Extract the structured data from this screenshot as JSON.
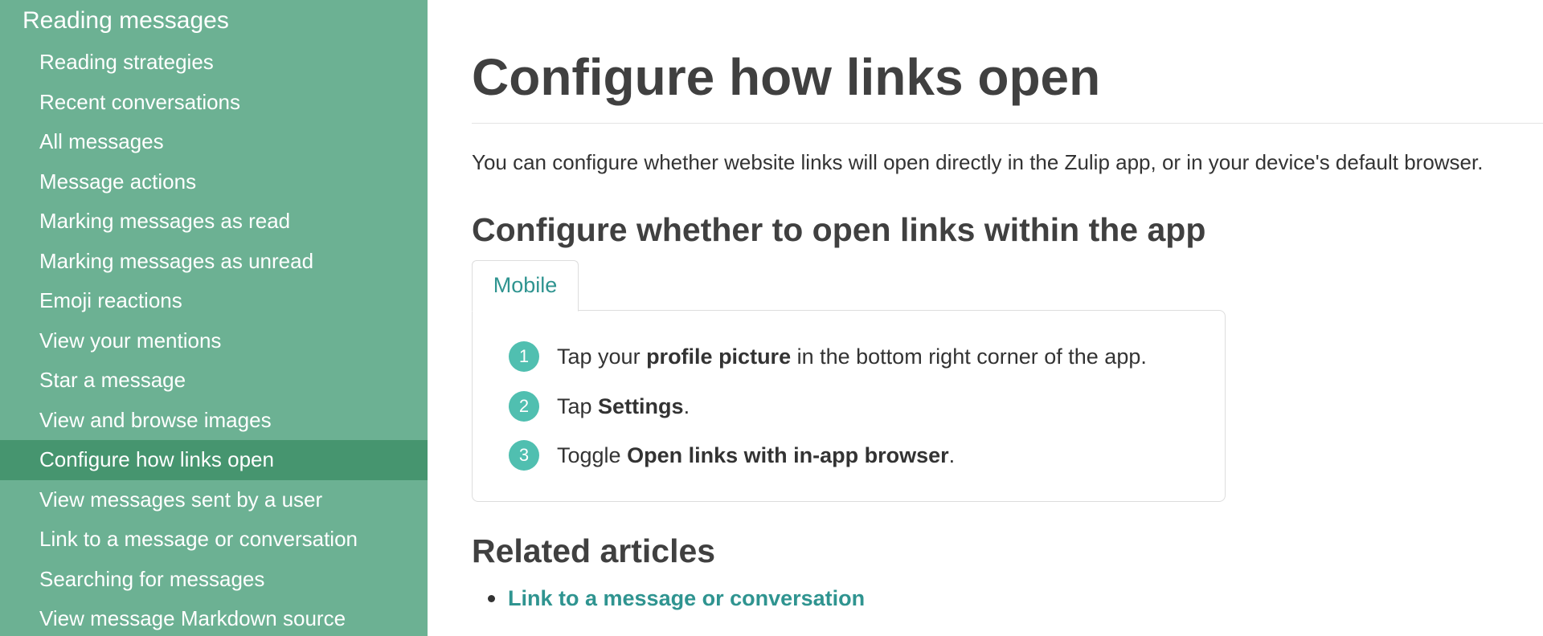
{
  "sidebar": {
    "heading": "Reading messages",
    "items": [
      {
        "label": "Reading strategies"
      },
      {
        "label": "Recent conversations"
      },
      {
        "label": "All messages"
      },
      {
        "label": "Message actions"
      },
      {
        "label": "Marking messages as read"
      },
      {
        "label": "Marking messages as unread"
      },
      {
        "label": "Emoji reactions"
      },
      {
        "label": "View your mentions"
      },
      {
        "label": "Star a message"
      },
      {
        "label": "View and browse images"
      },
      {
        "label": "Configure how links open",
        "active": true
      },
      {
        "label": "View messages sent by a user"
      },
      {
        "label": "Link to a message or conversation"
      },
      {
        "label": "Searching for messages"
      },
      {
        "label": "View message Markdown source"
      }
    ],
    "background_color": "#6cb193",
    "active_color": "#46956f"
  },
  "main": {
    "title": "Configure how links open",
    "intro": "You can configure whether website links will open directly in the Zulip app, or in your device's default browser.",
    "section_heading": "Configure whether to open links within the app",
    "tabs": [
      {
        "label": "Mobile",
        "selected": true
      }
    ],
    "steps": [
      {
        "number": "1",
        "before": "Tap your ",
        "bold": "profile picture",
        "after": " in the bottom right corner of the app."
      },
      {
        "number": "2",
        "before": "Tap ",
        "bold": "Settings",
        "after": "."
      },
      {
        "number": "3",
        "before": "Toggle ",
        "bold": "Open links with in-app browser",
        "after": "."
      }
    ],
    "related_heading": "Related articles",
    "related_links": [
      {
        "label": "Link to a message or conversation"
      }
    ],
    "accent_color": "#2f9490",
    "step_badge_color": "#50bfb0"
  }
}
